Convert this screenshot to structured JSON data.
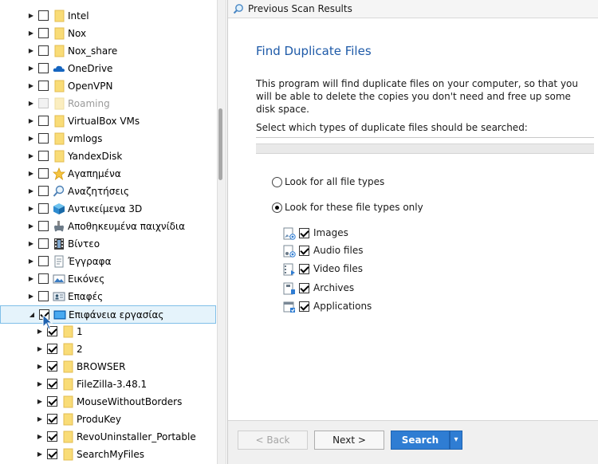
{
  "tree": {
    "items": [
      {
        "label": "Intel",
        "icon": "folder-icon",
        "checked": false,
        "expanded": false
      },
      {
        "label": "Nox",
        "icon": "folder-icon",
        "checked": false,
        "expanded": false
      },
      {
        "label": "Nox_share",
        "icon": "folder-icon",
        "checked": false,
        "expanded": false
      },
      {
        "label": "OneDrive",
        "icon": "onedrive-cloud-icon",
        "checked": false,
        "expanded": false
      },
      {
        "label": "OpenVPN",
        "icon": "folder-icon",
        "checked": false,
        "expanded": false
      },
      {
        "label": "Roaming",
        "icon": "folder-icon",
        "checked": false,
        "expanded": false,
        "disabled": true
      },
      {
        "label": "VirtualBox VMs",
        "icon": "folder-icon",
        "checked": false,
        "expanded": false
      },
      {
        "label": "vmlogs",
        "icon": "folder-icon",
        "checked": false,
        "expanded": false
      },
      {
        "label": "YandexDisk",
        "icon": "folder-icon",
        "checked": false,
        "expanded": false
      },
      {
        "label": "Αγαπημένα",
        "icon": "favorites-star-icon",
        "checked": false,
        "expanded": false
      },
      {
        "label": "Αναζητήσεις",
        "icon": "search-magnifier-icon",
        "checked": false,
        "expanded": false
      },
      {
        "label": "Αντικείμενα 3D",
        "icon": "cube-3d-icon",
        "checked": false,
        "expanded": false
      },
      {
        "label": "Αποθηκευμένα παιχνίδια",
        "icon": "saved-games-icon",
        "checked": false,
        "expanded": false
      },
      {
        "label": "Βίντεο",
        "icon": "video-folder-icon",
        "checked": false,
        "expanded": false
      },
      {
        "label": "Έγγραφα",
        "icon": "documents-icon",
        "checked": false,
        "expanded": false
      },
      {
        "label": "Εικόνες",
        "icon": "pictures-icon",
        "checked": false,
        "expanded": false
      },
      {
        "label": "Επαφές",
        "icon": "contacts-icon",
        "checked": false,
        "expanded": false
      },
      {
        "label": "Επιφάνεια εργασίας",
        "icon": "desktop-icon",
        "checked": true,
        "expanded": true,
        "selected": true
      },
      {
        "label": "1",
        "icon": "folder-icon",
        "checked": true,
        "expanded": false,
        "child": true
      },
      {
        "label": "2",
        "icon": "folder-icon",
        "checked": true,
        "expanded": false,
        "child": true
      },
      {
        "label": "BROWSER",
        "icon": "folder-icon",
        "checked": true,
        "expanded": false,
        "child": true
      },
      {
        "label": "FileZilla-3.48.1",
        "icon": "folder-icon",
        "checked": true,
        "expanded": false,
        "child": true
      },
      {
        "label": "MouseWithoutBorders",
        "icon": "folder-icon",
        "checked": true,
        "expanded": false,
        "child": true
      },
      {
        "label": "ProduKey",
        "icon": "folder-icon",
        "checked": true,
        "expanded": false,
        "child": true
      },
      {
        "label": "RevoUninstaller_Portable",
        "icon": "folder-icon",
        "checked": true,
        "expanded": false,
        "child": true
      },
      {
        "label": "SearchMyFiles",
        "icon": "folder-icon",
        "checked": true,
        "expanded": false,
        "child": true
      }
    ]
  },
  "topbar": {
    "title": "Previous Scan Results",
    "icon": "magnifier-icon"
  },
  "main": {
    "heading": "Find Duplicate Files",
    "description": "This program will find duplicate files on your computer, so that you will be able to delete the copies you don't need and free up some disk space.",
    "select_label": "Select which types of duplicate files should be searched:",
    "radio_all": "Look for all file types",
    "radio_only": "Look for these file types only",
    "selected_radio": "only",
    "file_types": [
      {
        "label": "Images",
        "icon": "image-file-icon",
        "checked": true
      },
      {
        "label": "Audio files",
        "icon": "audio-file-icon",
        "checked": true
      },
      {
        "label": "Video files",
        "icon": "video-file-icon",
        "checked": true
      },
      {
        "label": "Archives",
        "icon": "archive-file-icon",
        "checked": true
      },
      {
        "label": "Applications",
        "icon": "application-file-icon",
        "checked": true
      }
    ]
  },
  "footer": {
    "back": "< Back",
    "next": "Next >",
    "search": "Search",
    "dropdown": "▾"
  },
  "colors": {
    "accent": "#2f7dd3",
    "heading": "#1e5aa8",
    "folder": "#f9dc77"
  }
}
